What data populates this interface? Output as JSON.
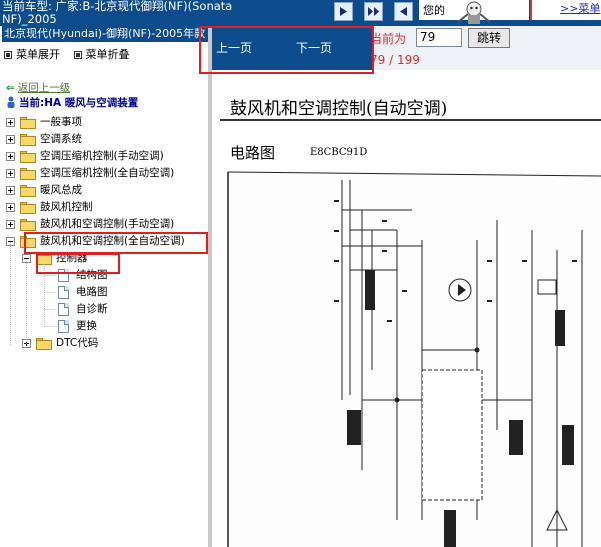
{
  "header": {
    "car_model_line1": "当前车型:  广家:B-北京现代御翔(NF)(Sonata",
    "car_model_line2": "NF)_2005",
    "greeting": "您的",
    "top_menu": ">>菜单"
  },
  "sidebar": {
    "vehicle_bar": "北京现代(Hyundai)-御翔(NF)-2005年款",
    "expand_label": "菜单展开",
    "collapse_label": "菜单折叠",
    "back_link": "返回上一级",
    "current": "当前:HA 暖风与空调装置",
    "tree": [
      {
        "label": "一般事项"
      },
      {
        "label": "空调系统"
      },
      {
        "label": "空调压缩机控制(手动空调)"
      },
      {
        "label": "空调压缩机控制(全自动空调)"
      },
      {
        "label": "暖风总成"
      },
      {
        "label": "鼓风机控制"
      },
      {
        "label": "鼓风机和空调控制(手动空调)"
      },
      {
        "label": "鼓风机和空调控制(全自动空调)"
      },
      {
        "label": "控制器"
      },
      {
        "label": "结构图"
      },
      {
        "label": "电路图"
      },
      {
        "label": "自诊断"
      },
      {
        "label": "更换"
      },
      {
        "label": "DTC代码"
      }
    ]
  },
  "pager": {
    "prev_label": "上一页",
    "next_label": "下一页",
    "current_label": "当前为",
    "current_page": "79",
    "jump_label": "跳转",
    "page_count": "79 / 199"
  },
  "document": {
    "title": "鼓风机和空调控制(自动空调)",
    "section_title": "电路图",
    "section_code": "E8CBC91D"
  },
  "colors": {
    "header_blue": "#0d4c8c",
    "highlight_red": "#e02020",
    "folder_yellow": "#f8d868"
  }
}
